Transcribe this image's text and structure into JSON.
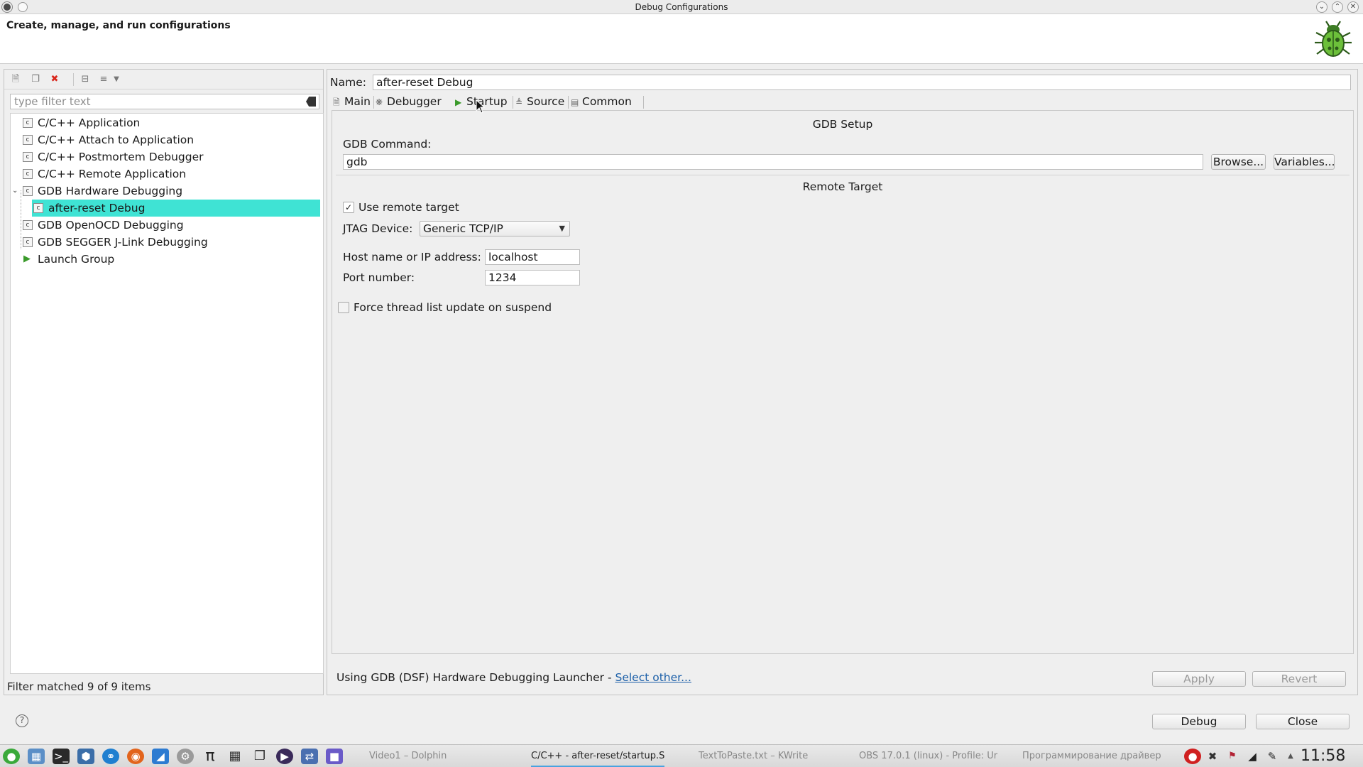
{
  "window": {
    "title": "Debug Configurations",
    "header_text": "Create, manage, and run configurations"
  },
  "left_panel": {
    "filter_placeholder": "type filter text",
    "tree": [
      {
        "label": "C/C++ Application",
        "icon": "c-config-icon"
      },
      {
        "label": "C/C++ Attach to Application",
        "icon": "c-config-icon"
      },
      {
        "label": "C/C++ Postmortem Debugger",
        "icon": "c-config-icon"
      },
      {
        "label": "C/C++ Remote Application",
        "icon": "c-config-icon"
      },
      {
        "label": "GDB Hardware Debugging",
        "icon": "c-config-icon",
        "expanded": true
      },
      {
        "label": "after-reset Debug",
        "icon": "c-config-icon",
        "selected": true,
        "child": true
      },
      {
        "label": "GDB OpenOCD Debugging",
        "icon": "c-config-icon"
      },
      {
        "label": "GDB SEGGER J-Link Debugging",
        "icon": "c-config-icon"
      },
      {
        "label": "Launch Group",
        "icon": "launch-group-icon"
      }
    ],
    "status": "Filter matched 9 of 9 items"
  },
  "right_panel": {
    "name_label": "Name:",
    "name_value": "after-reset Debug",
    "tabs": [
      {
        "label": "Main",
        "icon": "main-tab-icon"
      },
      {
        "label": "Debugger",
        "icon": "debugger-tab-icon",
        "active": true
      },
      {
        "label": "Startup",
        "icon": "startup-tab-icon"
      },
      {
        "label": "Source",
        "icon": "source-tab-icon"
      },
      {
        "label": "Common",
        "icon": "common-tab-icon"
      }
    ],
    "gdb_setup": {
      "title": "GDB Setup",
      "command_label": "GDB Command:",
      "command_value": "gdb",
      "browse_label": "Browse...",
      "variables_label": "Variables..."
    },
    "remote_target": {
      "title": "Remote Target",
      "use_remote_label": "Use remote target",
      "use_remote_checked": true,
      "jtag_label": "JTAG Device:",
      "jtag_value": "Generic TCP/IP",
      "host_label": "Host name or IP address:",
      "host_value": "localhost",
      "port_label": "Port number:",
      "port_value": "1234"
    },
    "force_thread_label": "Force thread list update on suspend",
    "force_thread_checked": false,
    "launcher_text": "Using GDB (DSF) Hardware Debugging Launcher - ",
    "launcher_link": "Select other...",
    "apply_label": "Apply",
    "revert_label": "Revert"
  },
  "footer": {
    "debug_label": "Debug",
    "close_label": "Close"
  },
  "taskbar": {
    "tasks": [
      {
        "label": "Video1 – Dolphin"
      },
      {
        "label": "C/C++ - after-reset/startup.S",
        "active": true
      },
      {
        "label": "TextToPaste.txt – KWrite"
      },
      {
        "label": "OBS 17.0.1 (linux) - Profile: Ur"
      },
      {
        "label": "Программирование драйвер"
      }
    ],
    "clock": "11:58"
  },
  "colors": {
    "selection": "#3fe3d4",
    "link": "#1b5fa8",
    "delete_red": "#d9261c"
  }
}
